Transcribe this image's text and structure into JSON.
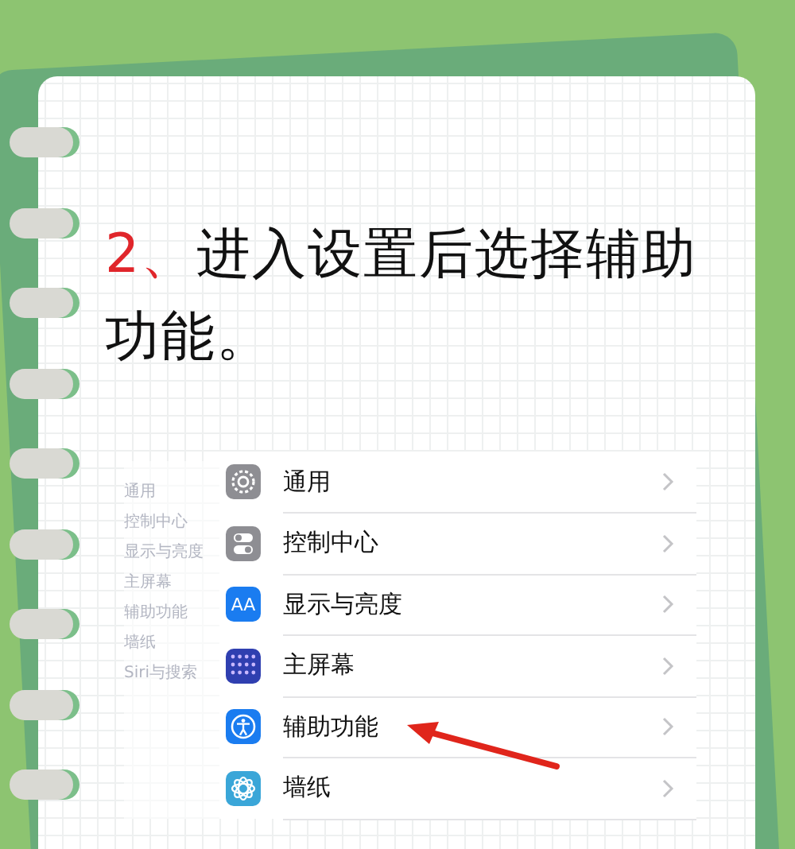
{
  "heading": {
    "step": "2、",
    "text": "进入设置后选择辅助功能。"
  },
  "screenshot": {
    "sidebar": [
      "通用",
      "控制中心",
      "显示与亮度",
      "主屏幕",
      "辅助功能",
      "墙纸",
      "Siri与搜索"
    ],
    "rows": [
      {
        "label": "通用",
        "kind": "gear",
        "pointed": false
      },
      {
        "label": "控制中心",
        "kind": "toggles",
        "pointed": false
      },
      {
        "label": "显示与亮度",
        "kind": "text",
        "icon_text": "AA",
        "pointed": false
      },
      {
        "label": "主屏幕",
        "kind": "grid",
        "pointed": false
      },
      {
        "label": "辅助功能",
        "kind": "accessibility",
        "pointed": true
      },
      {
        "label": "墙纸",
        "kind": "flower",
        "pointed": false
      }
    ]
  }
}
